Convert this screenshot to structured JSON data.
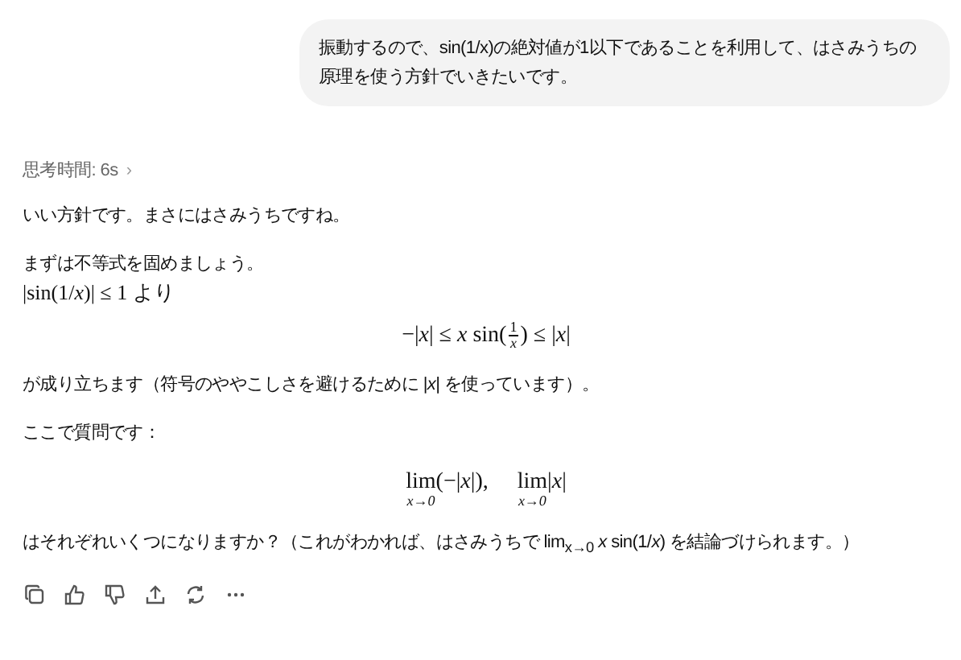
{
  "user_message": {
    "text": "振動するので、sin(1/x)の絶対値が1以下であることを利用して、はさみうちの原理を使う方針でいきたいです。"
  },
  "thinking": {
    "label": "思考時間: 6s",
    "chevron": "›"
  },
  "blocks": [
    {
      "kind": "text",
      "text": "いい方針です。まさにはさみうちですね。"
    },
    {
      "kind": "text",
      "text": "まずは不等式を固めましょう。"
    },
    {
      "kind": "mathline",
      "text": "|sin(1/*x*)| ≤ 1 より"
    },
    {
      "kind": "fraction",
      "before": "−|*x*| ≤ *x* sin(",
      "num": "1",
      "den": "x",
      "after": ") ≤ |*x*|"
    },
    {
      "kind": "text",
      "text": "が成り立ちます（符号のややこしさを避けるために |*x*| を使っています）。"
    },
    {
      "kind": "text",
      "text": "ここで質問です："
    },
    {
      "kind": "limits",
      "items": [
        {
          "op": "lim",
          "sub": "x→0",
          "expr": "(−|*x*|),"
        },
        {
          "op": "lim",
          "sub": "x→0",
          "expr": "|*x*|"
        }
      ]
    },
    {
      "kind": "text",
      "text": "はそれぞれいくつになりますか？（これがわかれば、はさみうちで lim$_{x→0}$ *x* sin(1/*x*) を結論づけられます。）"
    }
  ],
  "actions": [
    {
      "kind": "copy"
    },
    {
      "kind": "thumbs-up"
    },
    {
      "kind": "thumbs-down"
    },
    {
      "kind": "share"
    },
    {
      "kind": "regenerate"
    },
    {
      "kind": "more"
    }
  ]
}
